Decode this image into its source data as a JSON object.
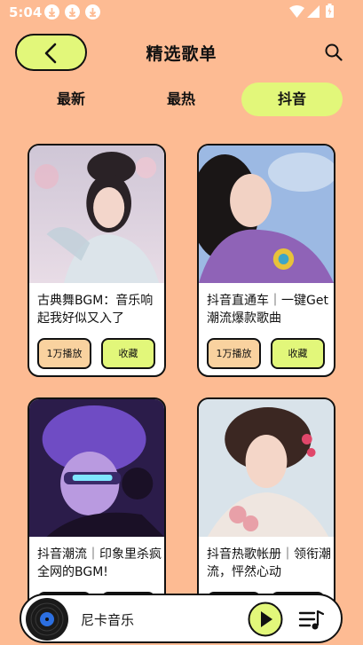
{
  "status_bar": {
    "time": "5:04",
    "icons": [
      "download-icon",
      "download-icon",
      "download-icon",
      "wifi-icon",
      "signal-icon",
      "battery-icon"
    ]
  },
  "header": {
    "title": "精选歌单",
    "back_icon": "chevron-left-icon",
    "search_icon": "search-icon"
  },
  "tabs": [
    {
      "label": "最新",
      "active": false
    },
    {
      "label": "最热",
      "active": false
    },
    {
      "label": "抖音",
      "active": true
    }
  ],
  "playlists": [
    {
      "title": "古典舞BGM：音乐响起我好似又入了",
      "plays": "1万播放",
      "fav": "收藏"
    },
    {
      "title": "抖音直通车｜一键Get潮流爆款歌曲",
      "plays": "1万播放",
      "fav": "收藏"
    },
    {
      "title": "抖音潮流｜印象里杀疯全网的BGM!",
      "plays": "",
      "fav": ""
    },
    {
      "title": "抖音热歌帐册｜领衔潮流，怦然心动",
      "plays": "",
      "fav": ""
    }
  ],
  "player": {
    "song": "尼卡音乐",
    "play_icon": "play-icon",
    "playlist_icon": "playlist-icon"
  },
  "colors": {
    "background": "#FDBB93",
    "accent": "#E2F77A",
    "plays_button": "#F9D29F"
  }
}
